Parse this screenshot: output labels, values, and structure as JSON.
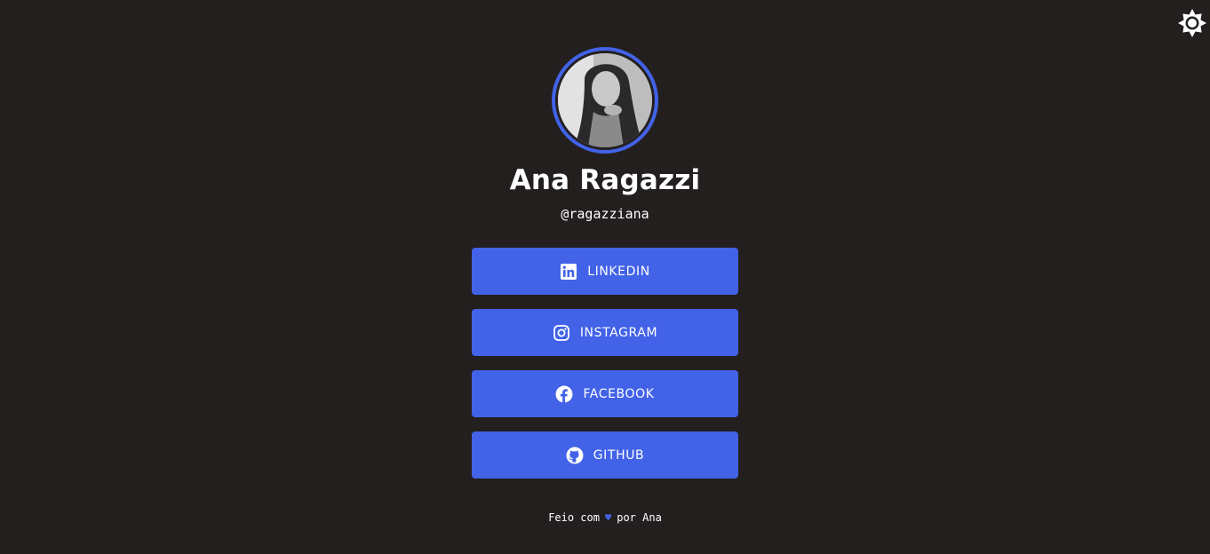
{
  "theme_toggle": {
    "icon": "sun-icon"
  },
  "profile": {
    "name": "Ana Ragazzi",
    "handle": "@ragazziana",
    "avatar_alt": "Ana Ragazzi"
  },
  "links": [
    {
      "label": "LINKEDIN",
      "icon": "linkedin-icon"
    },
    {
      "label": "INSTAGRAM",
      "icon": "instagram-icon"
    },
    {
      "label": "FACEBOOK",
      "icon": "facebook-icon"
    },
    {
      "label": "GITHUB",
      "icon": "github-icon"
    }
  ],
  "footer": {
    "prefix": "Feio com",
    "heart": "♥",
    "suffix": "por Ana"
  },
  "colors": {
    "background": "#231f1f",
    "accent": "#4262e8",
    "text": "#ffffff"
  }
}
